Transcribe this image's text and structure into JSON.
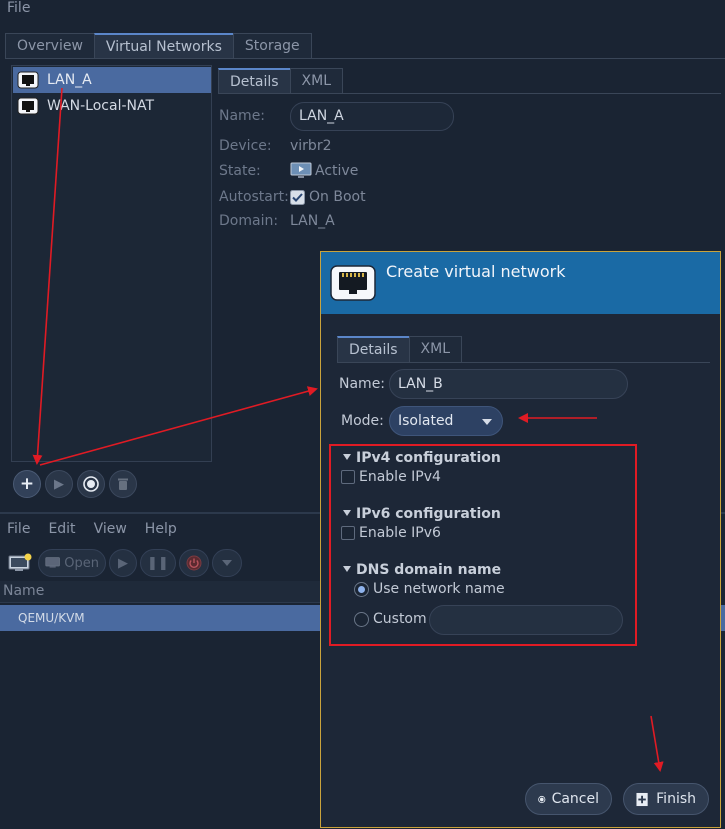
{
  "top_window": {
    "menu": [
      "File"
    ],
    "tabs": [
      "Overview",
      "Virtual Networks",
      "Storage"
    ],
    "networks": [
      "LAN_A",
      "WAN-Local-NAT"
    ],
    "details_tabs": [
      "Details",
      "XML"
    ],
    "fields": {
      "name_label": "Name:",
      "name_value": "LAN_A",
      "device_label": "Device:",
      "device_value": "virbr2",
      "state_label": "State:",
      "state_value": "Active",
      "autostart_label": "Autostart:",
      "autostart_value": "On Boot",
      "domain_label": "Domain:",
      "domain_value": "LAN_A"
    },
    "action_buttons": {
      "add": "+"
    }
  },
  "bottom_window": {
    "menu": [
      "File",
      "Edit",
      "View",
      "Help"
    ],
    "toolbar": {
      "open_label": "Open"
    },
    "column_header": "Name",
    "rows": [
      "QEMU/KVM"
    ]
  },
  "dialog": {
    "title": "Create virtual network",
    "tabs": [
      "Details",
      "XML"
    ],
    "name_label": "Name:",
    "name_value": "LAN_B",
    "mode_label": "Mode:",
    "mode_value": "Isolated",
    "ipv4": {
      "title": "IPv4 configuration",
      "enable_label": "Enable IPv4"
    },
    "ipv6": {
      "title": "IPv6 configuration",
      "enable_label": "Enable IPv6"
    },
    "dns": {
      "title": "DNS domain name",
      "use_network_name_label": "Use network name",
      "custom_label": "Custom",
      "custom_value": ""
    },
    "cancel_label": "Cancel",
    "finish_label": "Finish"
  },
  "colors": {
    "accent_header": "#1a6aa5",
    "selection": "#4a6aa0",
    "annotation_red": "#e01b24",
    "dialog_border": "#c9a33c"
  }
}
